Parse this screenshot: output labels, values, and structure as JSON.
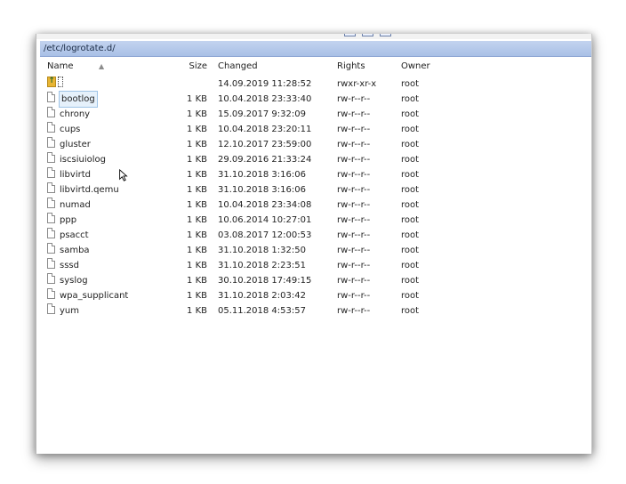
{
  "path": "/etc/logrotate.d/",
  "columns": {
    "name": "Name",
    "size": "Size",
    "changed": "Changed",
    "rights": "Rights",
    "owner": "Owner"
  },
  "parent_row": {
    "changed": "14.09.2019 11:28:52",
    "rights": "rwxr-xr-x",
    "owner": "root"
  },
  "files": [
    {
      "name": "bootlog",
      "size": "1 KB",
      "changed": "10.04.2018 23:33:40",
      "rights": "rw-r--r--",
      "owner": "root"
    },
    {
      "name": "chrony",
      "size": "1 KB",
      "changed": "15.09.2017 9:32:09",
      "rights": "rw-r--r--",
      "owner": "root"
    },
    {
      "name": "cups",
      "size": "1 KB",
      "changed": "10.04.2018 23:20:11",
      "rights": "rw-r--r--",
      "owner": "root"
    },
    {
      "name": "gluster",
      "size": "1 KB",
      "changed": "12.10.2017 23:59:00",
      "rights": "rw-r--r--",
      "owner": "root"
    },
    {
      "name": "iscsiuiolog",
      "size": "1 KB",
      "changed": "29.09.2016 21:33:24",
      "rights": "rw-r--r--",
      "owner": "root"
    },
    {
      "name": "libvirtd",
      "size": "1 KB",
      "changed": "31.10.2018 3:16:06",
      "rights": "rw-r--r--",
      "owner": "root"
    },
    {
      "name": "libvirtd.qemu",
      "size": "1 KB",
      "changed": "31.10.2018 3:16:06",
      "rights": "rw-r--r--",
      "owner": "root"
    },
    {
      "name": "numad",
      "size": "1 KB",
      "changed": "10.04.2018 23:34:08",
      "rights": "rw-r--r--",
      "owner": "root"
    },
    {
      "name": "ppp",
      "size": "1 KB",
      "changed": "10.06.2014 10:27:01",
      "rights": "rw-r--r--",
      "owner": "root"
    },
    {
      "name": "psacct",
      "size": "1 KB",
      "changed": "03.08.2017 12:00:53",
      "rights": "rw-r--r--",
      "owner": "root"
    },
    {
      "name": "samba",
      "size": "1 KB",
      "changed": "31.10.2018 1:32:50",
      "rights": "rw-r--r--",
      "owner": "root"
    },
    {
      "name": "sssd",
      "size": "1 KB",
      "changed": "31.10.2018 2:23:51",
      "rights": "rw-r--r--",
      "owner": "root"
    },
    {
      "name": "syslog",
      "size": "1 KB",
      "changed": "30.10.2018 17:49:15",
      "rights": "rw-r--r--",
      "owner": "root"
    },
    {
      "name": "wpa_supplicant",
      "size": "1 KB",
      "changed": "31.10.2018 2:03:42",
      "rights": "rw-r--r--",
      "owner": "root"
    },
    {
      "name": "yum",
      "size": "1 KB",
      "changed": "05.11.2018 4:53:57",
      "rights": "rw-r--r--",
      "owner": "root"
    }
  ],
  "selected_file": "bootlog",
  "icons": {
    "parent": "parent-directory-icon",
    "file": "file-icon",
    "cursor": "mouse-cursor-icon"
  },
  "colors": {
    "pathbar": "#b6c9ea",
    "selection": "#e6f1fb"
  }
}
